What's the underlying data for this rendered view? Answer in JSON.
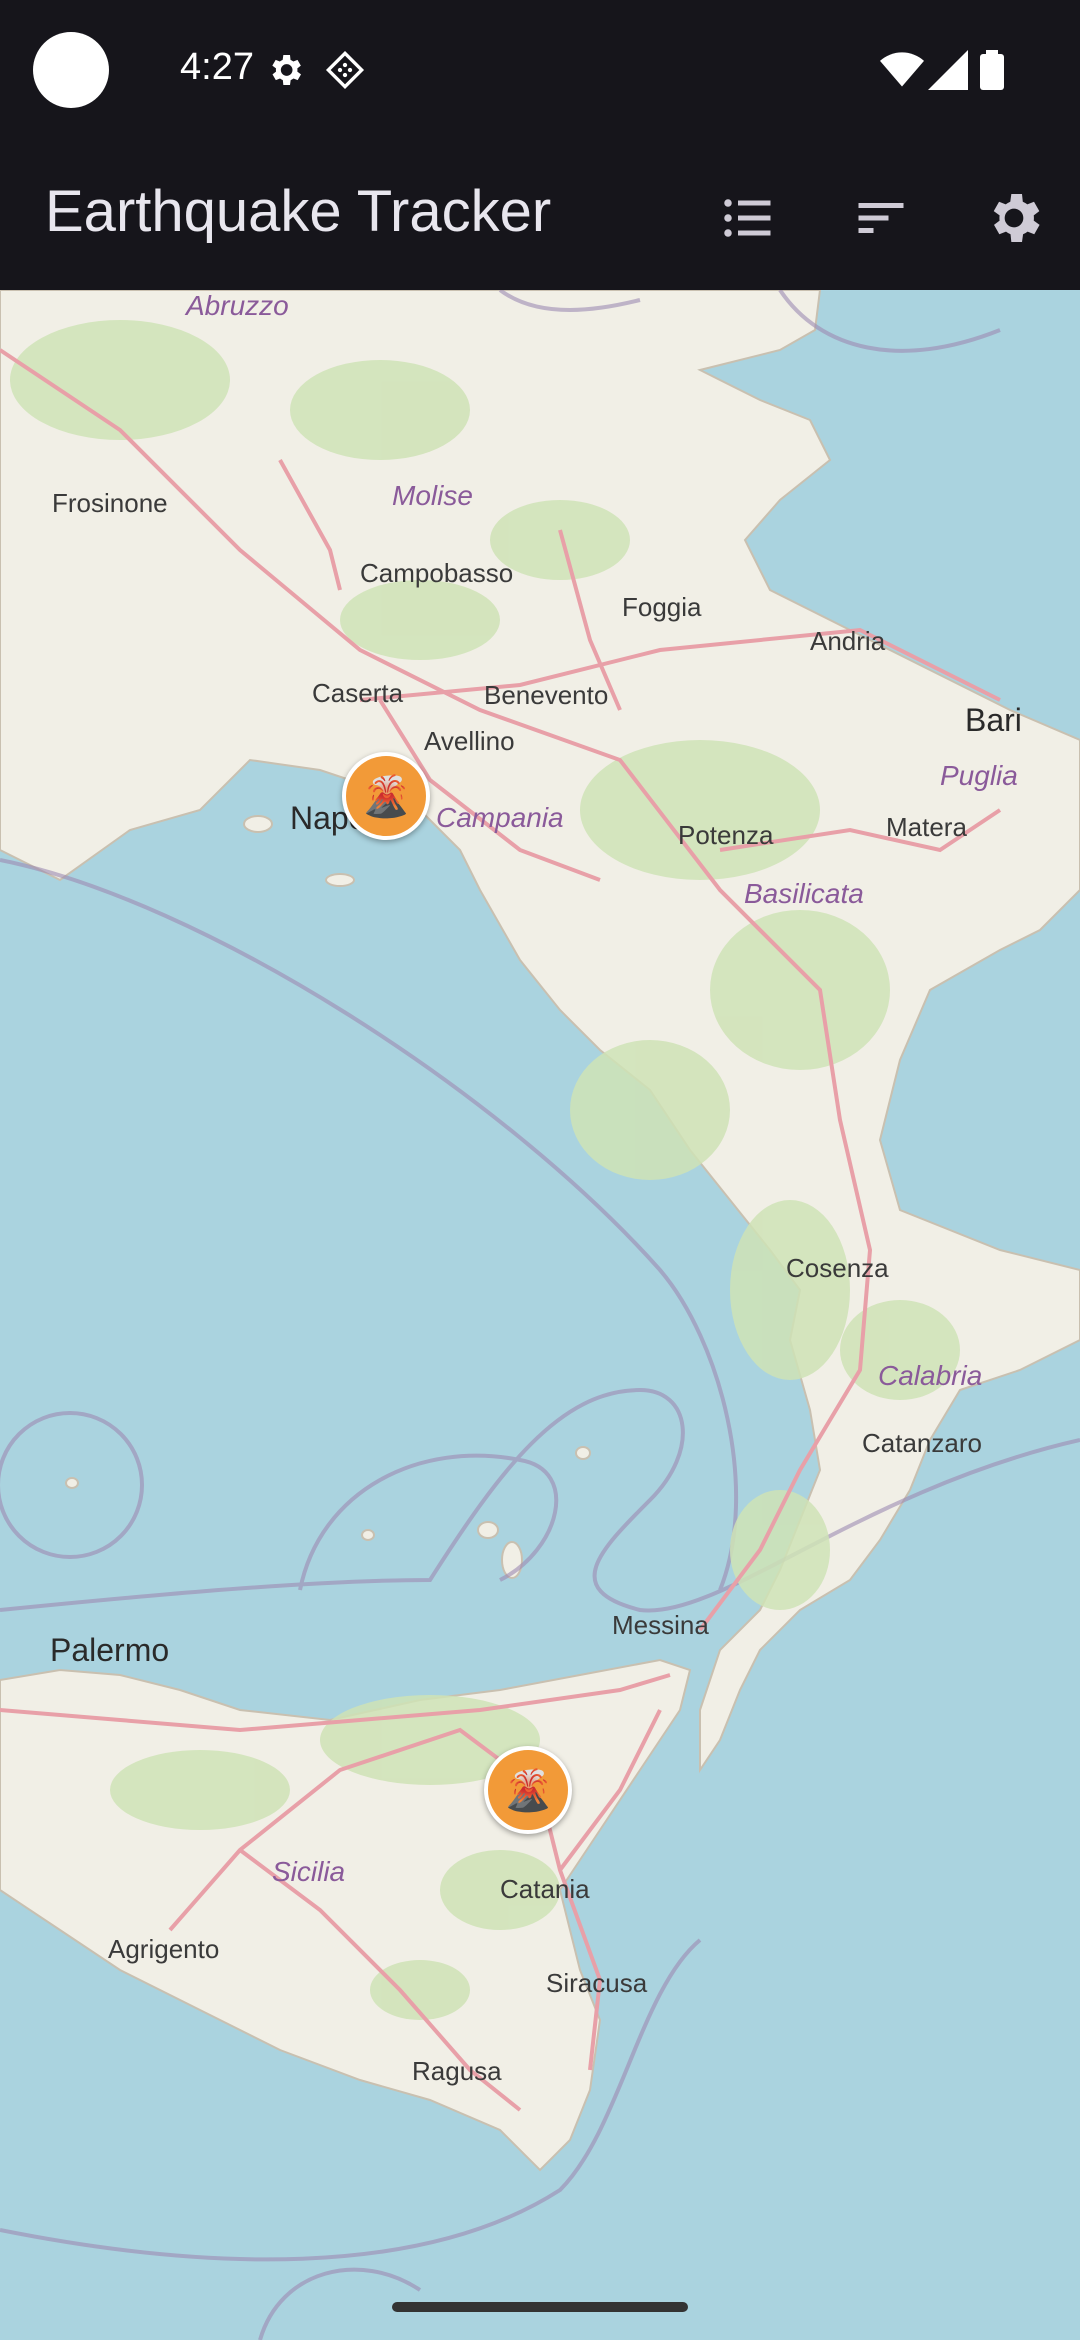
{
  "status_bar": {
    "time": "4:27",
    "icons": [
      "settings-gear-icon",
      "diamond-data-icon",
      "wifi-icon",
      "signal-icon",
      "battery-icon"
    ]
  },
  "app_bar": {
    "title": "Earthquake Tracker",
    "actions": [
      {
        "name": "list-view-icon"
      },
      {
        "name": "sort-icon"
      },
      {
        "name": "settings-icon"
      }
    ]
  },
  "map": {
    "places": [
      {
        "label": "Frosinone"
      },
      {
        "label": "Campobasso"
      },
      {
        "label": "Foggia"
      },
      {
        "label": "Andria"
      },
      {
        "label": "Bari"
      },
      {
        "label": "Caserta"
      },
      {
        "label": "Benevento"
      },
      {
        "label": "Avellino"
      },
      {
        "label": "Napoli"
      },
      {
        "label": "Potenza"
      },
      {
        "label": "Matera"
      },
      {
        "label": "Cosenza"
      },
      {
        "label": "Catanzaro"
      },
      {
        "label": "Messina"
      },
      {
        "label": "Palermo"
      },
      {
        "label": "Catania"
      },
      {
        "label": "Agrigento"
      },
      {
        "label": "Siracusa"
      },
      {
        "label": "Ragusa"
      }
    ],
    "regions": [
      {
        "label": "Abruzzo"
      },
      {
        "label": "Molise"
      },
      {
        "label": "Campania"
      },
      {
        "label": "Puglia"
      },
      {
        "label": "Basilicata"
      },
      {
        "label": "Calabria"
      },
      {
        "label": "Sicilia"
      }
    ],
    "markers": [
      {
        "name": "volcano-marker-vesuvius",
        "icon": "🌋"
      },
      {
        "name": "volcano-marker-etna",
        "icon": "🌋"
      }
    ],
    "colors": {
      "sea": "#aad3df",
      "land": "#f1efe6",
      "road": "#e8a0a8",
      "marker": "#f29a38"
    }
  }
}
